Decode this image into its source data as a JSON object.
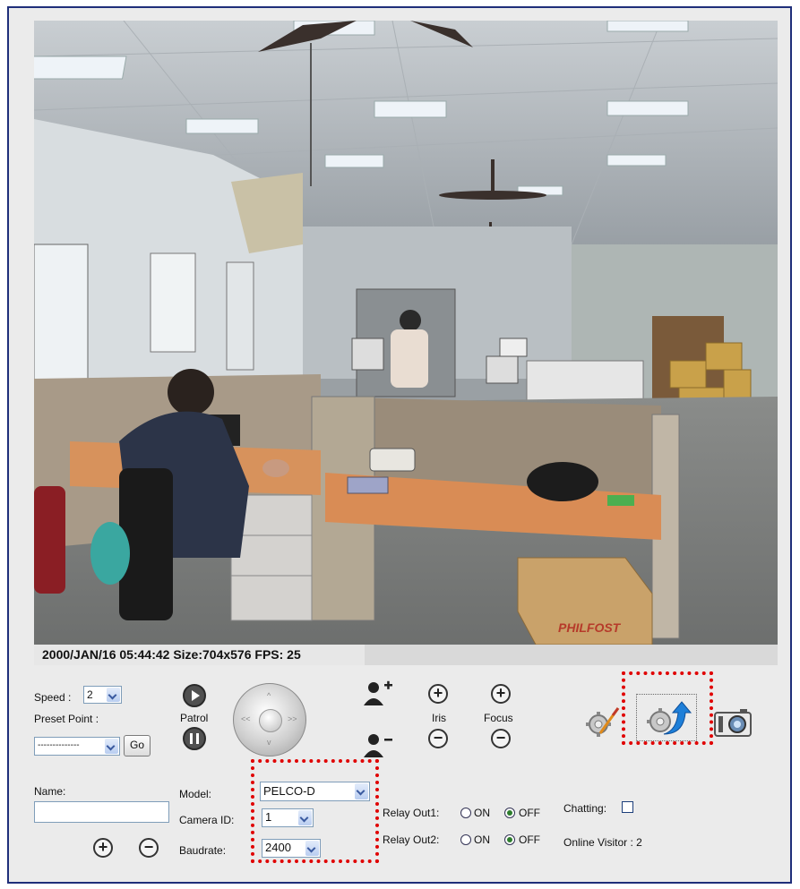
{
  "video": {
    "osd_text": "2000/JAN/16 05:44:42 Size:704x576 FPS: 25",
    "watermark": "PHILFOST"
  },
  "ptz": {
    "speed_label": "Speed :",
    "speed_value": "2",
    "preset_label": "Preset Point :",
    "preset_value": "--------------",
    "go_label": "Go",
    "patrol_label": "Patrol",
    "iris_label": "Iris",
    "focus_label": "Focus",
    "joystick_left": "<<",
    "joystick_right": ">>",
    "joystick_up": "^",
    "joystick_down": "v"
  },
  "preset_name": {
    "name_label": "Name:",
    "name_value": ""
  },
  "camera": {
    "model_label": "Model:",
    "model_value": "PELCO-D",
    "camera_id_label": "Camera ID:",
    "camera_id_value": "1",
    "baudrate_label": "Baudrate:",
    "baudrate_value": "2400"
  },
  "relay": {
    "out1_label": "Relay Out1:",
    "out2_label": "Relay Out2:",
    "on_label": "ON",
    "off_label": "OFF",
    "out1_state": "OFF",
    "out2_state": "OFF"
  },
  "status": {
    "chatting_label": "Chatting:",
    "online_visitor": "Online Visitor : 2"
  },
  "icons": [
    "patrol-play-icon",
    "patrol-pause-icon",
    "zoom-in-person-icon",
    "zoom-out-person-icon",
    "settings-icon",
    "upgrade-icon",
    "snapshot-camera-icon"
  ],
  "colors": {
    "border": "#1f2f7a",
    "highlight": "#e00000",
    "panel": "#ebebeb"
  }
}
